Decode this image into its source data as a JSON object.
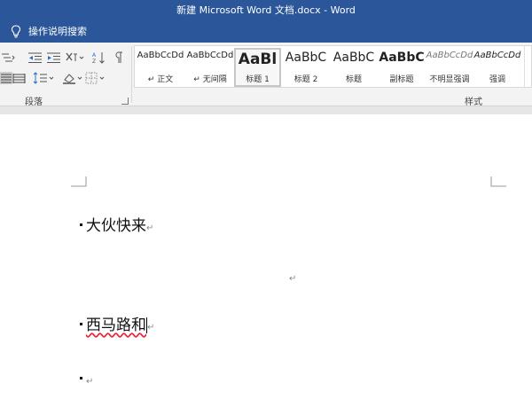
{
  "window": {
    "title": "新建 Microsoft Word 文档.docx  -  Word"
  },
  "tell_me": {
    "label": "操作说明搜索"
  },
  "ribbon": {
    "paragraph_group_label": "段落",
    "styles_group_label": "样式",
    "styles": [
      {
        "preview": "AaBbCcDd",
        "name": "↵ 正文",
        "selected": false
      },
      {
        "preview": "AaBbCcDd",
        "name": "↵ 无间隔",
        "selected": false
      },
      {
        "preview": "AaBl",
        "name": "标题 1",
        "selected": true
      },
      {
        "preview": "AaBbC",
        "name": "标题 2",
        "selected": false
      },
      {
        "preview": "AaBbC",
        "name": "标题",
        "selected": false
      },
      {
        "preview": "AaBbC",
        "name": "副标题",
        "selected": false
      },
      {
        "preview": "AaBbCcDd",
        "name": "不明显强调",
        "selected": false
      },
      {
        "preview": "AaBbCcDd",
        "name": "强调",
        "selected": false
      }
    ]
  },
  "document": {
    "paragraphs": [
      {
        "text": "大伙快来",
        "bulleted": true
      },
      {
        "text": "",
        "bulleted": false
      },
      {
        "text": "西马路和",
        "bulleted": true
      },
      {
        "text": "",
        "bulleted": true
      }
    ],
    "paragraph_mark": "↵"
  },
  "colors": {
    "title_bar": "#2b579a",
    "ribbon": "#f3f3f3",
    "spelling_error": "#e23"
  }
}
